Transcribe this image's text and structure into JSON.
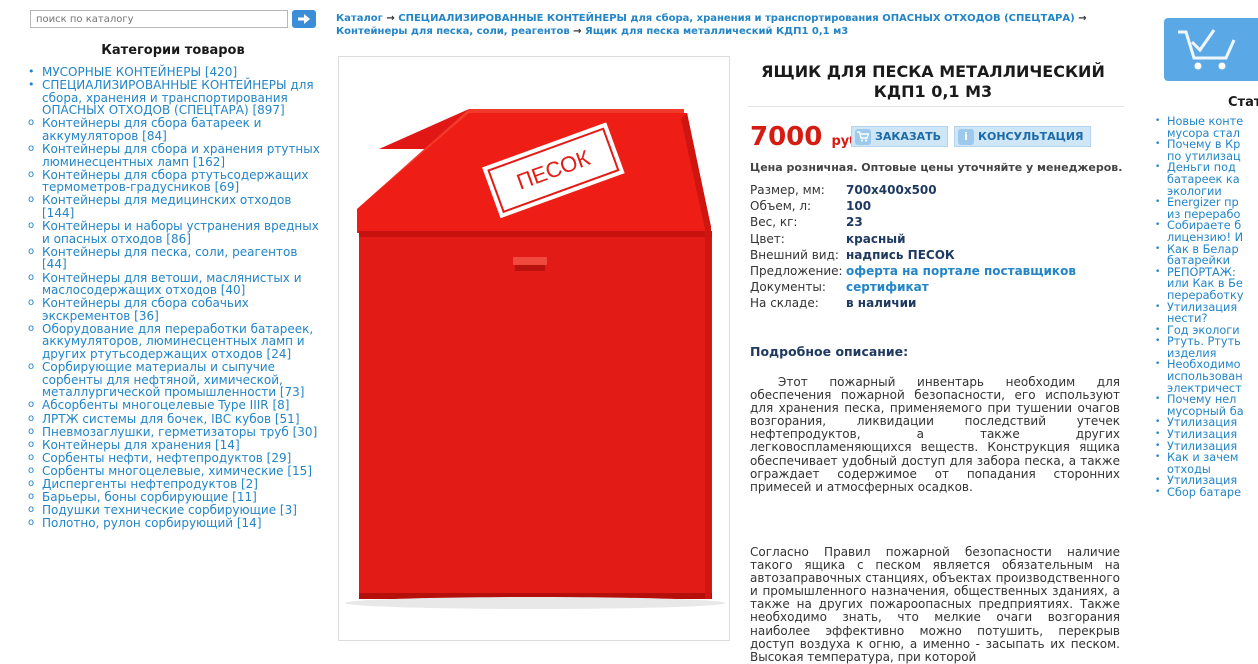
{
  "search": {
    "placeholder": "поиск по каталогу"
  },
  "sidebar": {
    "title": "Категории товаров",
    "items": [
      "МУСОРНЫЕ КОНТЕЙНЕРЫ [420]",
      "СПЕЦИАЛИЗИРОВАННЫЕ КОНТЕЙНЕРЫ для сбора, хранения и транспортирования ОПАСНЫХ ОТХОДОВ (СПЕЦТАРА) [897]",
      "Контейнеры для сбора батареек и аккумуляторов [84]",
      "Контейнеры для сбора и хранения ртутных люминесцентных ламп [162]",
      "Контейнеры для сбора ртутьсодержащих термометров-градусников [69]",
      "Контейнеры для медицинских отходов [144]",
      "Контейнеры и наборы устранения вредных и опасных отходов [86]",
      "Контейнеры для песка, соли, реагентов [44]",
      "Контейнеры для ветоши, маслянистых и маслосодержащих отходов [40]",
      "Контейнеры для сбора собачьих экскрементов [36]",
      "Оборудование для переработки батареек, аккумуляторов, люминесцентных ламп и других ртутьсодержащих отходов [24]",
      "Сорбирующие материалы и сыпучие сорбенты для нефтяной, химической, металлургической промышленности [73]",
      "Абсорбенты многоцелевые Type IIIR [8]",
      "ЛРТЖ системы для бочек, IBC кубов [51]",
      "Пневмозаглушки, герметизаторы труб [30]",
      "Контейнеры для хранения [14]",
      "Сорбенты нефти, нефтепродуктов [29]",
      "Сорбенты многоцелевые, химические [15]",
      "Диспергенты нефтепродуктов [2]",
      "Барьеры, боны сорбирующие [11]",
      "Подушки технические сорбирующие [3]",
      "Полотно, рулон сорбирующий [14]"
    ]
  },
  "breadcrumb": {
    "items": [
      "Каталог",
      "СПЕЦИАЛИЗИРОВАННЫЕ КОНТЕЙНЕРЫ для сбора, хранения и транспортирования ОПАСНЫХ ОТХОДОВ (СПЕЦТАРА)",
      "Контейнеры для песка, соли, реагентов",
      "Ящик для песка металлический КДП1 0,1 м3"
    ],
    "arrow": "→"
  },
  "product": {
    "image_label": "ПЕСОК",
    "title": "ЯЩИК ДЛЯ ПЕСКА МЕТАЛЛИЧЕСКИЙ КДП1 0,1 М3",
    "price": "7000",
    "currency": "руб.",
    "order_label": "ЗАКАЗАТЬ",
    "consult_label": "КОНСУЛЬТАЦИЯ",
    "retail_note": "Цена розничная. Оптовые цены уточняйте у менеджеров.",
    "specs": [
      {
        "k": "Размер, мм:",
        "v": "700x400x500"
      },
      {
        "k": "Объем, л:",
        "v": "100"
      },
      {
        "k": "Вес, кг:",
        "v": "23"
      },
      {
        "k": "Цвет:",
        "v": "красный"
      },
      {
        "k": "Внешний вид:",
        "v": "надпись ПЕСОК"
      },
      {
        "k": "Предложение:",
        "v": "оферта на портале поставщиков"
      },
      {
        "k": "Документы:",
        "v": "сертификат"
      },
      {
        "k": "На складе:",
        "v": "в наличии"
      }
    ],
    "desc_heading": "Подробное описание:",
    "desc_p1": "Этот пожарный инвентарь необходим для обеспечения пожарной безопасности, его используют для хранения песка, применяемого при тушении очагов возгорания, ликвидации последствий утечек нефтепродуктов, а также других легковоспламеняющихся веществ. Конструкция ящика обеспечивает удобный доступ для забора песка, а также ограждает содержимое от попадания сторонних примесей и атмосферных осадков.",
    "desc_p2": "Согласно Правил пожарной безопасности наличие такого ящика с песком является обязательным на автозаправочных станциях, объектах производственного и промышленного назначения, общественных зданиях, а также на других пожароопасных предприятиях. Также необходимо знать, что мелкие очаги возгорания наиболее эффективно можно потушить, перекрыв доступ воздуха к огню, а именно - засыпать их песком. Высокая температура, при которой"
  },
  "right": {
    "title": "Стат",
    "items": [
      "Новые конте\nмусора стал",
      "Почему в Кр\nпо утилизац",
      "Деньги под\nбатареек ка\nэкологии",
      "Energizer пр\nиз перерабо",
      "Собираете б\nлицензию! И",
      "Как в Белар\nбатарейки",
      "РЕПОРТАЖ:\nили Как в Бе\nпереработку",
      "Утилизация\nнести?",
      "Год экологи",
      "Ртуть. Ртуть\nизделия",
      "Необходимо\nиспользован\nэлектричест",
      "Почему нел\nмусорный ба",
      "Утилизация",
      "Утилизация",
      "Утилизация",
      "Как и зачем\nотходы",
      "Утилизация",
      "Сбор батаре"
    ]
  },
  "colors": {
    "accent": "#2385c6",
    "price": "#d71a12",
    "cart": "#5aa9e6"
  }
}
